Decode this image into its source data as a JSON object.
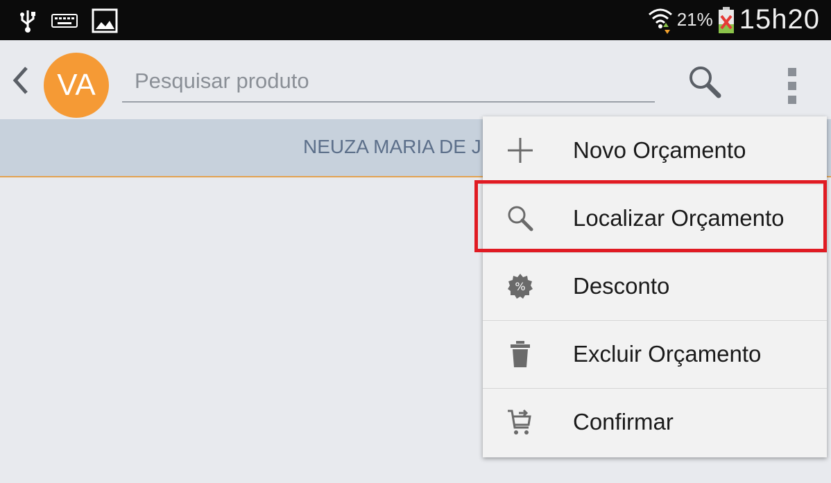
{
  "status_bar": {
    "icons": [
      "usb-icon",
      "keyboard-icon",
      "gallery-icon",
      "wifi-icon",
      "battery-icon"
    ],
    "battery_percent": "21%",
    "time": "15h20"
  },
  "action_bar": {
    "back_icon": "chevron-left-icon",
    "avatar_initials": "VA",
    "avatar_color": "#f59a35",
    "search_placeholder": "Pesquisar produto",
    "search_icon": "search-icon",
    "overflow_icon": "overflow-menu-icon"
  },
  "banner": {
    "customer_name": "NEUZA MARIA DE J"
  },
  "menu": {
    "items": [
      {
        "label": "Novo Orçamento",
        "icon": "plus-icon"
      },
      {
        "label": "Localizar Orçamento",
        "icon": "search-icon",
        "highlighted": true
      },
      {
        "label": "Desconto",
        "icon": "discount-badge-icon"
      },
      {
        "label": "Excluir Orçamento",
        "icon": "trash-icon"
      },
      {
        "label": "Confirmar",
        "icon": "cart-icon"
      }
    ],
    "highlight_color": "#e01b23"
  }
}
